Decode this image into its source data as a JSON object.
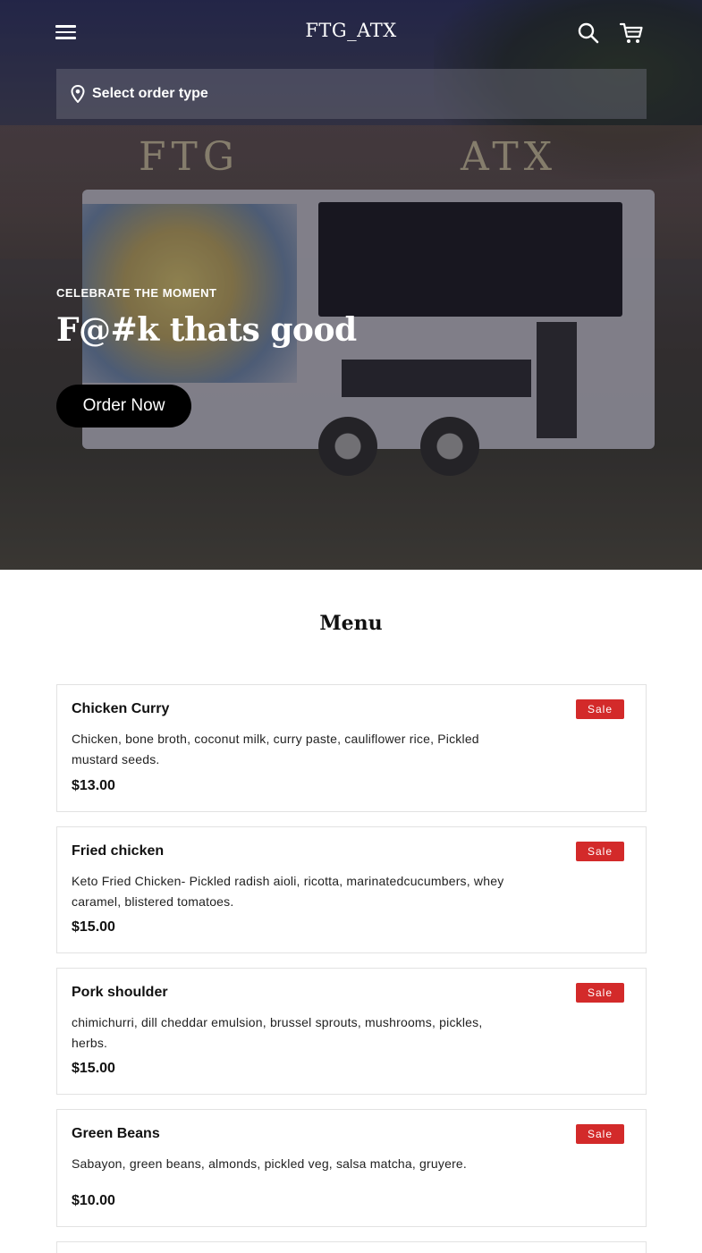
{
  "header": {
    "brand": "FTG_ATX",
    "menu_icon": "hamburger-menu-icon",
    "search_icon": "search-icon",
    "cart_icon": "cart-icon"
  },
  "order_type": {
    "label": "Select order type",
    "icon": "location-pin-icon"
  },
  "hero": {
    "sign_left": "FTG",
    "sign_right": "ATX",
    "eyebrow": "CELEBRATE THE MOMENT",
    "headline": "F@#k thats good",
    "cta_label": "Order Now"
  },
  "menu": {
    "title": "Menu",
    "items": [
      {
        "name": "Chicken Curry",
        "description": "Chicken, bone broth, coconut milk, curry paste, cauliflower rice, Pickled mustard seeds.",
        "price": "$13.00",
        "badge": "Sale"
      },
      {
        "name": "Fried chicken",
        "description": "Keto Fried Chicken- Pickled radish aioli, ricotta, marinatedcucumbers, whey caramel, blistered tomatoes.",
        "price": "$15.00",
        "badge": "Sale"
      },
      {
        "name": "Pork shoulder",
        "description": "chimichurri, dill cheddar emulsion, brussel sprouts, mushrooms, pickles, herbs.",
        "price": "$15.00",
        "badge": "Sale"
      },
      {
        "name": "Green Beans",
        "description": "Sabayon, green beans, almonds, pickled veg, salsa matcha, gruyere.",
        "price": "$10.00",
        "badge": "Sale"
      }
    ]
  },
  "colors": {
    "badge": "#d32a2a",
    "cta": "#000000",
    "card_border": "#e2e2e2"
  }
}
